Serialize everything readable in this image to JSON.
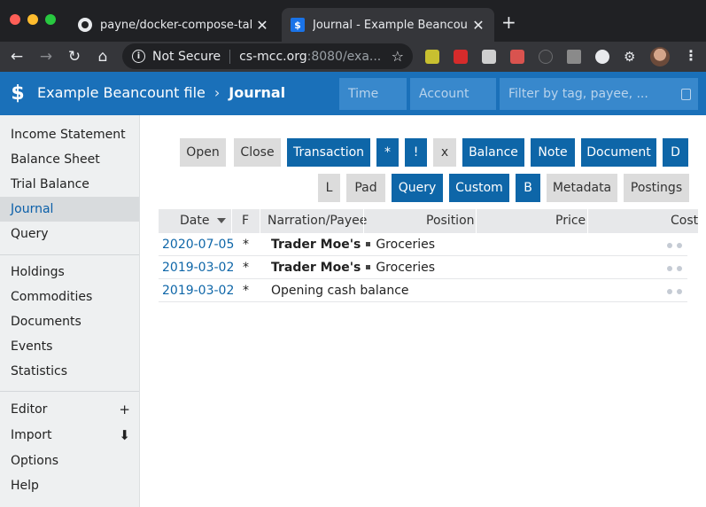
{
  "browser": {
    "tabs": [
      {
        "title": "payne/docker-compose-talk",
        "favicon": "github-icon"
      },
      {
        "title": "Journal - Example Beancount file",
        "favicon": "beancount-icon"
      }
    ],
    "close_glyph": "✕",
    "new_tab_glyph": "+",
    "security_label": "Not Secure",
    "url_host": "cs-mcc.org",
    "url_rest": ":8080/exa..."
  },
  "header": {
    "logo_glyph": "$",
    "title": "Example Beancount file",
    "separator": "›",
    "page": "Journal",
    "time_placeholder": "Time",
    "account_placeholder": "Account",
    "filter_placeholder": "Filter by tag, payee, ..."
  },
  "sidebar": {
    "group1": [
      "Income Statement",
      "Balance Sheet",
      "Trial Balance",
      "Journal",
      "Query"
    ],
    "group2": [
      "Holdings",
      "Commodities",
      "Documents",
      "Events",
      "Statistics"
    ],
    "group3": [
      "Editor",
      "Import",
      "Options",
      "Help"
    ],
    "active": "Journal",
    "editor_action": "+",
    "import_action": "⬇"
  },
  "filters": {
    "row1": [
      {
        "label": "Open",
        "active": false
      },
      {
        "label": "Close",
        "active": false
      },
      {
        "label": "Transaction",
        "active": true
      },
      {
        "label": "*",
        "active": true
      },
      {
        "label": "!",
        "active": true
      },
      {
        "label": "x",
        "active": false
      },
      {
        "label": "Balance",
        "active": true
      },
      {
        "label": "Note",
        "active": true
      },
      {
        "label": "Document",
        "active": true
      },
      {
        "label": "D",
        "active": true
      }
    ],
    "row2": [
      {
        "label": "L",
        "active": false
      },
      {
        "label": "Pad",
        "active": false
      },
      {
        "label": "Query",
        "active": true
      },
      {
        "label": "Custom",
        "active": true
      },
      {
        "label": "B",
        "active": true
      },
      {
        "label": "Metadata",
        "active": false
      },
      {
        "label": "Postings",
        "active": false
      }
    ]
  },
  "journal": {
    "columns": [
      "Date",
      "F",
      "Narration/Payee",
      "Position",
      "Price",
      "Cost"
    ],
    "rows": [
      {
        "date": "2020-07-05",
        "flag": "*",
        "payee": "Trader Moe's",
        "narration": "Groceries"
      },
      {
        "date": "2019-03-02",
        "flag": "*",
        "payee": "Trader Moe's",
        "narration": "Groceries"
      },
      {
        "date": "2019-03-02",
        "flag": "*",
        "payee": "",
        "narration": "Opening cash balance"
      }
    ]
  },
  "colors": {
    "header_blue": "#1a70b9",
    "active_button": "#0e66a8",
    "inactive_button": "#dcdcdc"
  }
}
